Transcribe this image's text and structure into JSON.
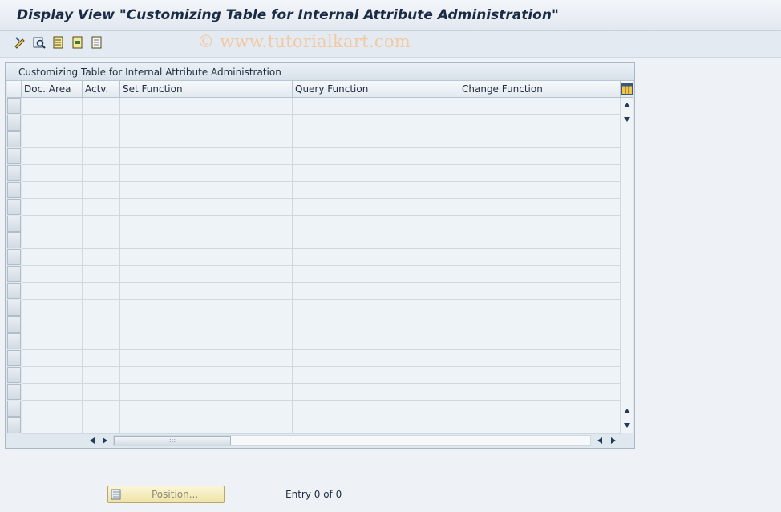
{
  "window": {
    "title": "Display View \"Customizing Table for Internal Attribute Administration\""
  },
  "toolbar": {
    "buttons": [
      {
        "name": "display-change-icon"
      },
      {
        "name": "find-icon"
      },
      {
        "name": "select-all-icon"
      },
      {
        "name": "select-block-icon"
      },
      {
        "name": "deselect-all-icon"
      }
    ],
    "watermark": "© www.tutorialkart.com"
  },
  "table": {
    "title": "Customizing Table for Internal Attribute Administration",
    "columns": [
      "Doc. Area",
      "Actv.",
      "Set Function",
      "Query Function",
      "Change Function"
    ],
    "rows": 20
  },
  "footer": {
    "position_label": "Position...",
    "entry_text": "Entry 0 of 0"
  },
  "colors": {
    "accent": "#1b2b44",
    "button_bg": "#efe3a6"
  }
}
